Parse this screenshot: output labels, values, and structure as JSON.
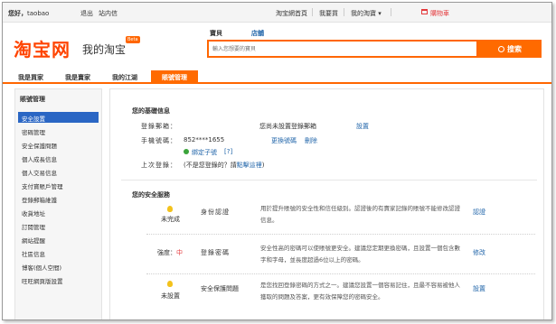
{
  "topbar": {
    "greeting": "您好，",
    "username": "taobao",
    "logout": "退出",
    "messages": "站内信",
    "home": "淘宝網首頁",
    "buy": "我要買",
    "my_taobao": "我的淘寶",
    "cart": "購物車",
    "favorites": "收藏夾",
    "search": "搜索",
    "site_nav": "網站導航"
  },
  "header": {
    "logo": "淘宝网",
    "logo_sub": "我的淘宝",
    "badge": "Beta",
    "tabs": [
      {
        "label": "寶貝"
      },
      {
        "label": "店舖"
      }
    ],
    "search_placeholder": "輸入您想要的寶貝",
    "search_button": "搜索"
  },
  "nav": {
    "items": [
      {
        "label": "我是買家"
      },
      {
        "label": "我是賣家"
      },
      {
        "label": "我的江湖"
      },
      {
        "label": "賬號管理"
      }
    ]
  },
  "sidebar": {
    "title": "賬號管理",
    "items": [
      {
        "label": "安全設置"
      },
      {
        "label": "密碼管理"
      },
      {
        "label": "安全保護問題"
      },
      {
        "label": "個人成長信息"
      },
      {
        "label": "個人交易信息"
      },
      {
        "label": "支付寶賬戶管理"
      },
      {
        "label": "登錄郵箱維護"
      },
      {
        "label": "收貨地址"
      },
      {
        "label": "訂閱管理"
      },
      {
        "label": "網站提醒"
      },
      {
        "label": "社區信息"
      },
      {
        "label": "博客(個人空間)"
      },
      {
        "label": "旺旺網頁版設置"
      }
    ]
  },
  "basic_info": {
    "title": "您的基礎信息",
    "email_label": "登錄郵箱：",
    "email_value": "您尚未設置登錄郵箱",
    "email_link": "設置",
    "phone_label": "手機號碼：",
    "phone_value": "852****1655",
    "phone_change": "更換號碼",
    "phone_delete": "刪除",
    "bind_sub": "綁定子號",
    "bind_help": "[?]",
    "last_login_label": "上次登錄：",
    "last_login_value": "(不是您登錄的？請",
    "last_login_link": "點擊這裡",
    "last_login_end": ")"
  },
  "security": {
    "title": "您的安全服務",
    "rows": [
      {
        "status": "未完成",
        "name": "身份認證",
        "description": "用於提升賬號的安全性和信任級別。認證後的有賣家記錄的賬號不能修改認證信息。",
        "action": "認證"
      },
      {
        "status_prefix": "強度：",
        "status_value": "中",
        "name": "登錄密碼",
        "description": "安全性高的密碼可以使賬號更安全。建議您定期更換密碼，且設置一個包含數字和字母，並長度超過6位以上的密碼。",
        "action": "修改"
      },
      {
        "status": "未設置",
        "name": "安全保護問題",
        "description": "是您找回登錄密碼的方式之一。建議您設置一個容易記住，且最不容易被他人獲取的問題及答案，更有效保障您的密碼安全。",
        "action": "設置"
      }
    ]
  },
  "colors": {
    "brand": "#ff4400",
    "accent": "#ff6a00",
    "sidebar_active": "#2a66c4",
    "link": "#2266aa"
  }
}
